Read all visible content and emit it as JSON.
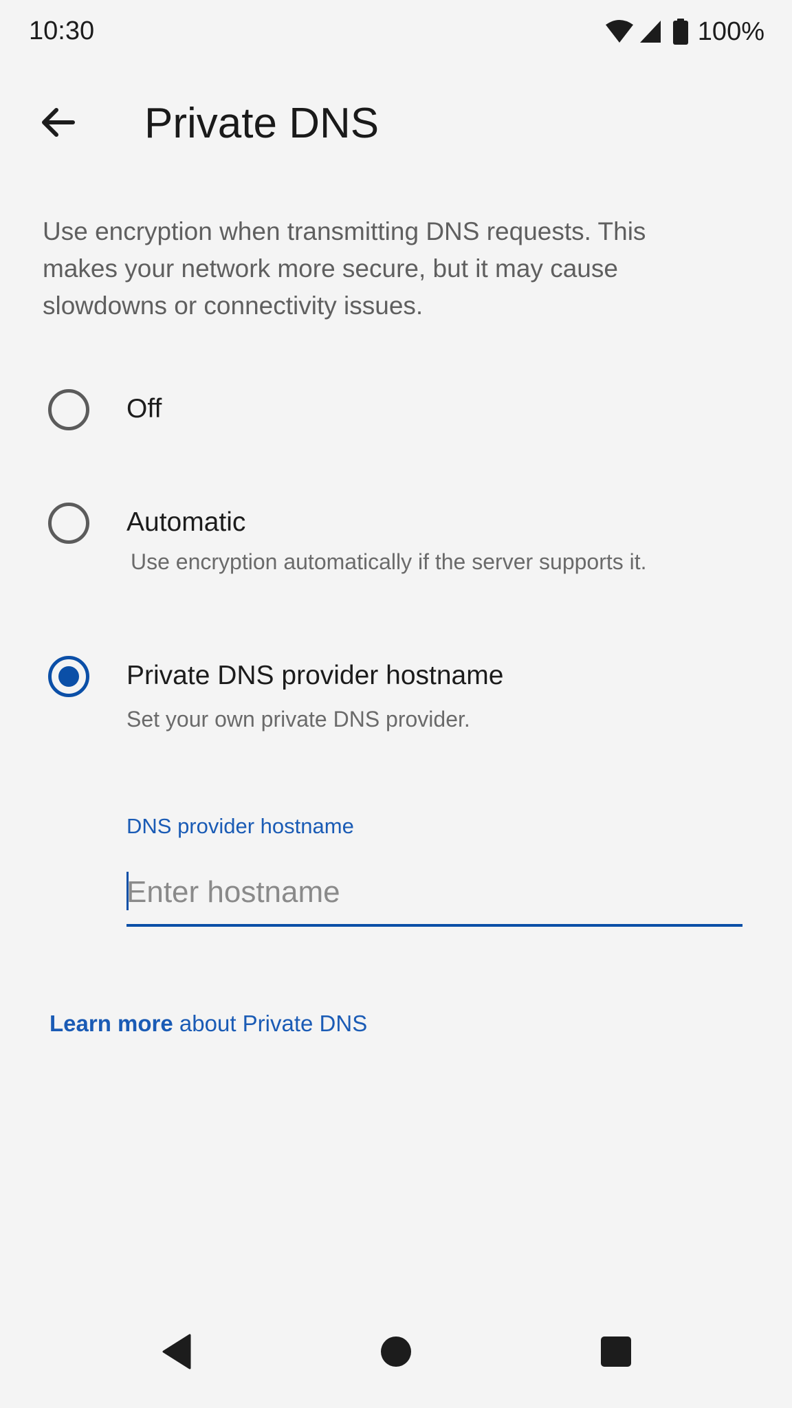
{
  "status_bar": {
    "time": "10:30",
    "battery_percent": "100%",
    "icons": [
      "wifi-icon",
      "cellular-signal-icon",
      "battery-icon"
    ]
  },
  "app_bar": {
    "back_icon": "arrow-back-icon",
    "title": "Private DNS"
  },
  "description": "Use encryption when transmitting DNS requests. This makes your network more secure, but it may cause slowdowns or connectivity issues.",
  "options": [
    {
      "label": "Off",
      "summary": "",
      "selected": false
    },
    {
      "label": "Automatic",
      "summary": "Use encryption automatically if the server supports it.",
      "selected": false
    },
    {
      "label": "Private DNS provider hostname",
      "summary": "Set your own private DNS provider.",
      "selected": true
    }
  ],
  "hostname_field": {
    "label": "DNS provider hostname",
    "placeholder": "Enter hostname",
    "value": ""
  },
  "learn_more": {
    "strong": "Learn more",
    "rest": " about Private DNS"
  },
  "nav_bar": {
    "back": "nav-back-icon",
    "home": "nav-home-icon",
    "recents": "nav-recents-icon"
  },
  "colors": {
    "accent": "#0b4fa7",
    "link": "#1a5bb5",
    "background": "#f4f4f4"
  }
}
